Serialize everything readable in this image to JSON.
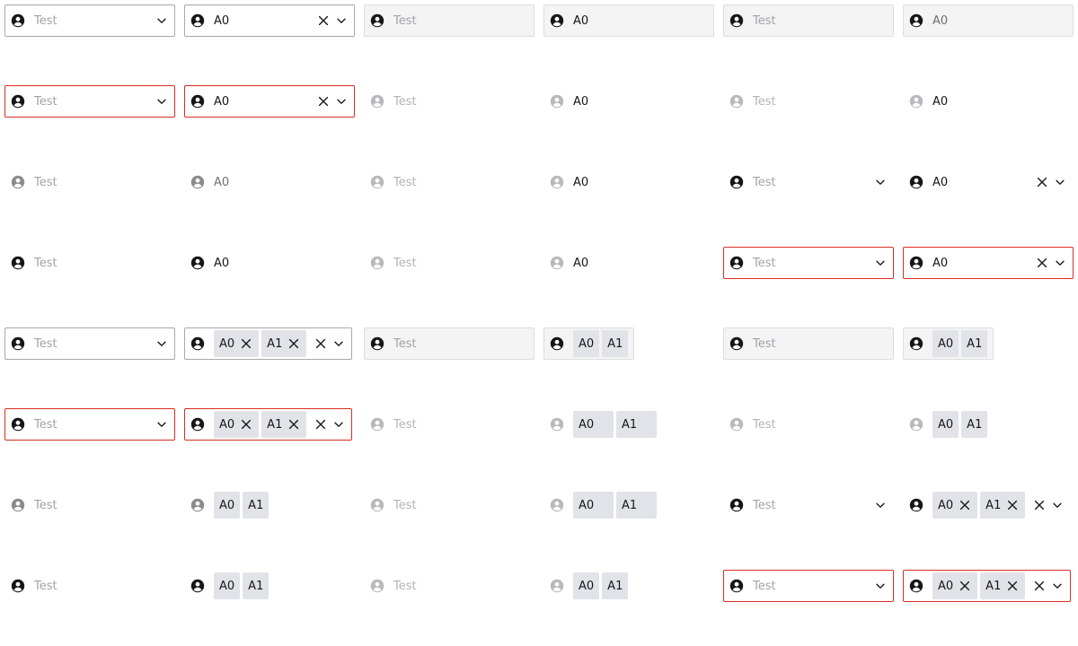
{
  "texts": {
    "placeholder": "Test"
  },
  "tags": [
    "A0",
    "A1"
  ],
  "icons": {
    "lead": "user-circle-icon",
    "clear": "close-icon",
    "open": "chevron-down-icon",
    "remove_tag": "close-icon"
  },
  "colors": {
    "invalid_border": "#d92d20",
    "tag_bg": "#e2e3e8",
    "placeholder": "#a2a3a8"
  },
  "rows": [
    [
      {
        "kind": "single",
        "value": "Test",
        "placeholder": true,
        "style": "bordered",
        "icon": "dark",
        "chevron": true
      },
      {
        "kind": "single",
        "value": "A0",
        "style": "bordered",
        "icon": "dark",
        "clear": true,
        "chevron": true
      },
      {
        "kind": "single",
        "value": "Test",
        "placeholder": true,
        "style": "filled",
        "icon": "dark"
      },
      {
        "kind": "single",
        "value": "A0",
        "style": "filled",
        "icon": "dark"
      },
      {
        "kind": "single",
        "value": "Test",
        "placeholder": true,
        "style": "filled",
        "icon": "dark"
      },
      {
        "kind": "single",
        "value": "A0",
        "style": "filled",
        "icon": "dark",
        "text": "grey"
      }
    ],
    [
      {
        "kind": "single",
        "value": "Test",
        "placeholder": true,
        "style": "invalid",
        "icon": "dark",
        "chevron": true
      },
      {
        "kind": "single",
        "value": "A0",
        "style": "invalid",
        "icon": "dark",
        "clear": true,
        "chevron": true
      },
      {
        "kind": "single",
        "value": "Test",
        "placeholder": true,
        "style": "bare",
        "icon": "light",
        "text": "light"
      },
      {
        "kind": "single",
        "value": "A0",
        "style": "bare",
        "icon": "light"
      },
      {
        "kind": "single",
        "value": "Test",
        "placeholder": true,
        "style": "bare",
        "icon": "light",
        "text": "light"
      },
      {
        "kind": "single",
        "value": "A0",
        "style": "bare",
        "icon": "light"
      }
    ],
    [
      {
        "kind": "single",
        "value": "Test",
        "placeholder": true,
        "style": "bare",
        "icon": "grey"
      },
      {
        "kind": "single",
        "value": "A0",
        "style": "bare",
        "icon": "grey",
        "text": "grey"
      },
      {
        "kind": "single",
        "value": "Test",
        "placeholder": true,
        "style": "bare",
        "icon": "light",
        "text": "light"
      },
      {
        "kind": "single",
        "value": "A0",
        "style": "bare",
        "icon": "light"
      },
      {
        "kind": "single",
        "value": "Test",
        "placeholder": true,
        "style": "bare",
        "icon": "dark",
        "chevron": true
      },
      {
        "kind": "single",
        "value": "A0",
        "style": "bare",
        "icon": "dark",
        "clear": true,
        "chevron": true
      }
    ],
    [
      {
        "kind": "single",
        "value": "Test",
        "placeholder": true,
        "style": "bare",
        "icon": "dark"
      },
      {
        "kind": "single",
        "value": "A0",
        "style": "bare",
        "icon": "dark"
      },
      {
        "kind": "single",
        "value": "Test",
        "placeholder": true,
        "style": "bare",
        "icon": "light",
        "text": "light"
      },
      {
        "kind": "single",
        "value": "A0",
        "style": "bare",
        "icon": "light"
      },
      {
        "kind": "single",
        "value": "Test",
        "placeholder": true,
        "style": "invalid",
        "icon": "dark",
        "chevron": true
      },
      {
        "kind": "single",
        "value": "A0",
        "style": "invalid",
        "icon": "dark",
        "clear": true,
        "chevron": true
      }
    ],
    [
      {
        "kind": "single",
        "value": "Test",
        "placeholder": true,
        "style": "bordered",
        "icon": "dark",
        "chevron": true
      },
      {
        "kind": "multi",
        "style": "bordered",
        "icon": "dark",
        "removable": true,
        "clear": true,
        "chevron": true
      },
      {
        "kind": "single",
        "value": "Test",
        "placeholder": true,
        "style": "filled",
        "icon": "dark"
      },
      {
        "kind": "multi",
        "style": "filled",
        "icon": "dark"
      },
      {
        "kind": "single",
        "value": "Test",
        "placeholder": true,
        "style": "filled",
        "icon": "dark"
      },
      {
        "kind": "multi",
        "style": "filled",
        "icon": "dark"
      }
    ],
    [
      {
        "kind": "single",
        "value": "Test",
        "placeholder": true,
        "style": "invalid",
        "icon": "dark",
        "chevron": true
      },
      {
        "kind": "multi",
        "style": "invalid",
        "icon": "dark",
        "removable": true,
        "clear": true,
        "chevron": true
      },
      {
        "kind": "single",
        "value": "Test",
        "placeholder": true,
        "style": "bare",
        "icon": "light",
        "text": "light"
      },
      {
        "kind": "multi",
        "style": "bare",
        "icon": "light",
        "wide": true
      },
      {
        "kind": "single",
        "value": "Test",
        "placeholder": true,
        "style": "bare",
        "icon": "light",
        "text": "light"
      },
      {
        "kind": "multi",
        "style": "bare",
        "icon": "light"
      }
    ],
    [
      {
        "kind": "single",
        "value": "Test",
        "placeholder": true,
        "style": "bare",
        "icon": "grey"
      },
      {
        "kind": "multi",
        "style": "bare",
        "icon": "grey"
      },
      {
        "kind": "single",
        "value": "Test",
        "placeholder": true,
        "style": "bare",
        "icon": "light",
        "text": "light"
      },
      {
        "kind": "multi",
        "style": "bare",
        "icon": "light",
        "wide": true
      },
      {
        "kind": "single",
        "value": "Test",
        "placeholder": true,
        "style": "bare",
        "icon": "dark",
        "chevron": true
      },
      {
        "kind": "multi",
        "style": "bare",
        "icon": "dark",
        "removable": true,
        "clear": true,
        "chevron": true
      }
    ],
    [
      {
        "kind": "single",
        "value": "Test",
        "placeholder": true,
        "style": "bare",
        "icon": "dark"
      },
      {
        "kind": "multi",
        "style": "bare",
        "icon": "dark"
      },
      {
        "kind": "single",
        "value": "Test",
        "placeholder": true,
        "style": "bare",
        "icon": "light",
        "text": "light"
      },
      {
        "kind": "multi",
        "style": "bare",
        "icon": "light"
      },
      {
        "kind": "single",
        "value": "Test",
        "placeholder": true,
        "style": "invalid",
        "icon": "dark",
        "chevron": true
      },
      {
        "kind": "multi",
        "style": "invalid",
        "icon": "dark",
        "removable": true,
        "clear": true,
        "chevron": true
      }
    ]
  ]
}
